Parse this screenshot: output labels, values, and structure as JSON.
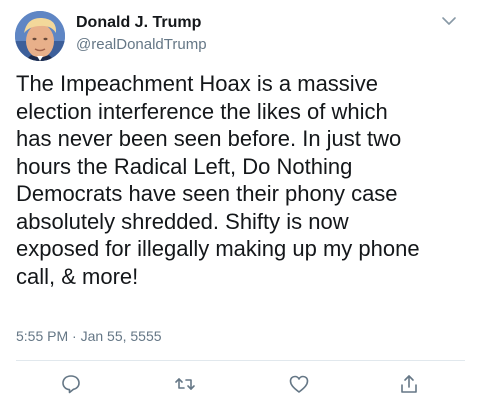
{
  "tweet": {
    "author": {
      "display_name": "Donald J. Trump",
      "handle": "@realDonaldTrump",
      "avatar_icon": "profile-photo"
    },
    "menu_icon": "chevron-down-icon",
    "text": "The Impeachment Hoax is a massive\nelection interference the likes of which\nhas never been seen before. In just two\nhours the Radical Left, Do Nothing\nDemocrats have seen their phony case\nabsolutely shredded. Shifty is now\nexposed for illegally making up my phone\ncall, & more!",
    "timestamp": "5:55 PM · Jan 55, 5555",
    "actions": {
      "reply_icon": "reply-icon",
      "retweet_icon": "retweet-icon",
      "like_icon": "heart-icon",
      "share_icon": "share-icon"
    }
  },
  "colors": {
    "text_primary": "#14171a",
    "text_secondary": "#657786",
    "divider": "#e1e8ed",
    "background": "#ffffff"
  }
}
